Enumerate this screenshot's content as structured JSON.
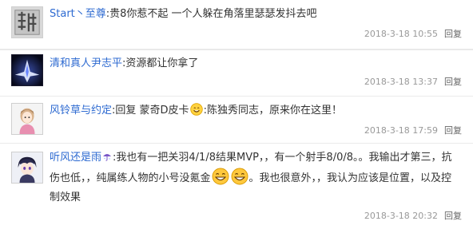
{
  "comments": [
    {
      "user": "Start丶至尊",
      "separator": ":",
      "text": "贵8你惹不起 一个人躲在角落里瑟瑟发抖去吧",
      "time": "2018-3-18 10:55",
      "reply": "回复"
    },
    {
      "user": "清和真人尹志平",
      "separator": ":",
      "text": "资源都让你拿了",
      "time": "2018-3-18 13:37",
      "reply": "回复"
    },
    {
      "user": "风铃草与约定",
      "separator": ":",
      "text_a": "回复 蒙奇D皮卡",
      "text_b": ":陈独秀同志，原来你在这里！",
      "time": "2018-3-18 17:59",
      "reply": "回复"
    },
    {
      "user": "听风还是雨",
      "separator": ":",
      "text_a": "我也有一把关羽4/1/8结果MVP，，有一个射手8/0/8。。我输出才第三，抗伤也低，，纯属练人物的小号没氪金",
      "text_b": "。我也很意外，，我认为应该是位置，以及控制效果",
      "time": "2018-3-18 20:32",
      "reply": "回复"
    }
  ],
  "colors": {
    "username": "#2d6ad1",
    "text": "#333333",
    "meta": "#999999",
    "divider": "#ebebeb"
  },
  "icons": [
    "avatar-qin-character",
    "avatar-star-logo",
    "avatar-anime-girl",
    "avatar-anime-boy",
    "vip-umbrella-icon",
    "smile-emoji",
    "grin-emoji"
  ]
}
